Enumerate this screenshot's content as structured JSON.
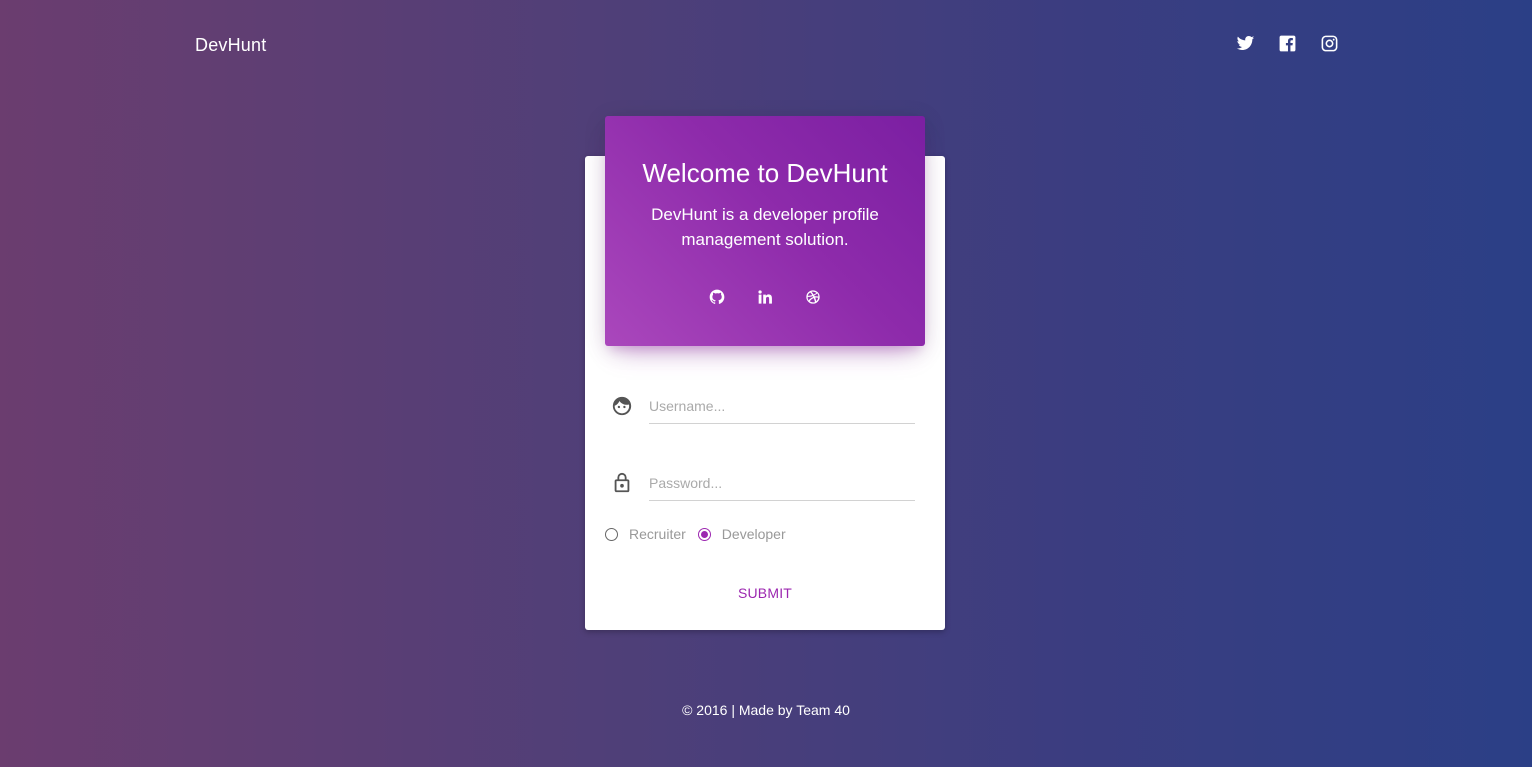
{
  "nav": {
    "brand": "DevHunt",
    "social": [
      "twitter-icon",
      "facebook-icon",
      "instagram-icon"
    ]
  },
  "card": {
    "title": "Welcome to DevHunt",
    "subtitle": "DevHunt is a developer profile management solution.",
    "header_icons": [
      "github-icon",
      "linkedin-icon",
      "dribbble-icon"
    ],
    "username_placeholder": "Username...",
    "password_placeholder": "Password...",
    "roles": [
      {
        "label": "Recruiter",
        "selected": false
      },
      {
        "label": "Developer",
        "selected": true
      }
    ],
    "submit_label": "SUBMIT"
  },
  "colors": {
    "accent": "#9c27b0",
    "header_gradient_start": "#aa47bc",
    "header_gradient_end": "#7b1fa2"
  },
  "footer": {
    "text": "© 2016 | Made by Team 40"
  }
}
